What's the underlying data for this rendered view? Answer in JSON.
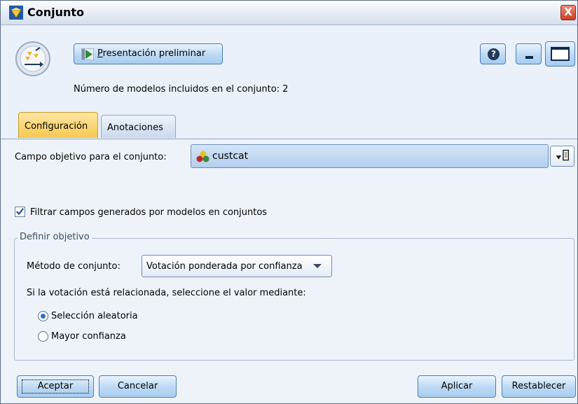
{
  "window": {
    "title": "Conjunto",
    "close_glyph": "X"
  },
  "icons": {
    "app": "ensemble-diamond-icon",
    "node": "ensemble-node-icon",
    "preview": "play-icon",
    "help": "help-icon",
    "minimize": "minimize-icon",
    "maximize": "maximize-icon",
    "field": "set-field-icon",
    "picker": "field-picker-icon"
  },
  "toolbar": {
    "preview_label": "Presentación preliminar",
    "help_glyph": "?"
  },
  "info": {
    "model_count": "Número de modelos incluidos en el conjunto: 2"
  },
  "tabs": [
    {
      "label": "Configuración",
      "active": true
    },
    {
      "label": "Anotaciones",
      "active": false
    }
  ],
  "settings": {
    "target_label": "Campo objetivo para el conjunto:",
    "target_value": "custcat",
    "filter_label": "Filtrar campos generados por modelos en conjuntos",
    "filter_checked": true
  },
  "group": {
    "legend": "Definir objetivo",
    "method_label": "Método de conjunto:",
    "method_value": "Votación ponderada por confianza",
    "tie_label": "Si la votación está relacionada, seleccione el valor mediante:",
    "options": [
      {
        "label": "Selección aleatoria",
        "selected": true
      },
      {
        "label": "Mayor confianza",
        "selected": false
      }
    ]
  },
  "buttons": {
    "ok": "Aceptar",
    "cancel": "Cancelar",
    "apply": "Aplicar",
    "reset": "Restablecer"
  },
  "colors": {
    "active_tab": "#f7c850",
    "button_fill": "#bcd9f4",
    "close": "#cc3e22",
    "radio_on": "#2c6fc6"
  }
}
